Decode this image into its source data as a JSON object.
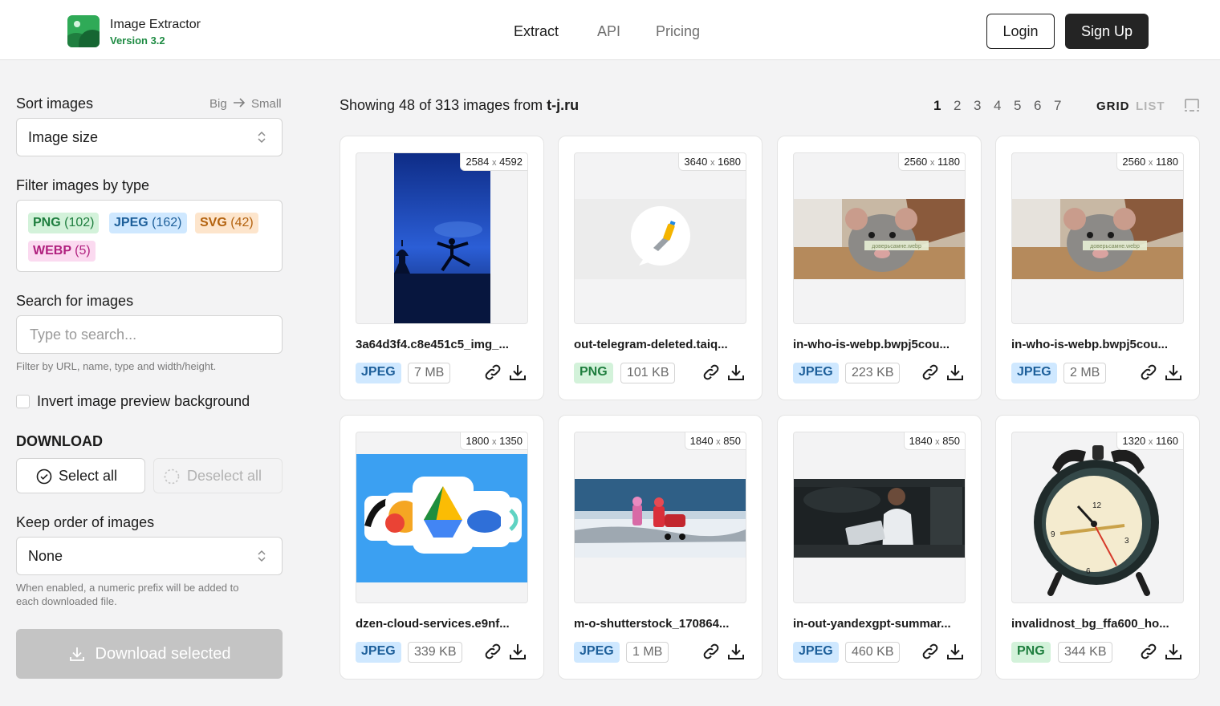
{
  "header": {
    "app_name": "Image Extractor",
    "version": "Version 3.2",
    "nav": [
      "Extract",
      "API",
      "Pricing"
    ],
    "login": "Login",
    "signup": "Sign Up"
  },
  "sidebar": {
    "sort_label": "Sort images",
    "sort_big": "Big",
    "sort_small": "Small",
    "sort_value": "Image size",
    "filter_label": "Filter images by type",
    "filters": [
      {
        "type": "PNG",
        "count": "(102)"
      },
      {
        "type": "JPEG",
        "count": "(162)"
      },
      {
        "type": "SVG",
        "count": "(42)"
      },
      {
        "type": "WEBP",
        "count": "(5)"
      }
    ],
    "search_label": "Search for images",
    "search_placeholder": "Type to search...",
    "search_hint": "Filter by URL, name, type and width/height.",
    "invert_label": "Invert image preview background",
    "download_title": "DOWNLOAD",
    "select_all": "Select all",
    "deselect_all": "Deselect all",
    "order_label": "Keep order of images",
    "order_value": "None",
    "order_hint_1": "When enabled, a numeric prefix will be added to",
    "order_hint_2": "each downloaded file.",
    "download_selected": "Download selected"
  },
  "main": {
    "showing_prefix": "Showing 48 of 313 images from",
    "domain": "t-j.ru",
    "pages": [
      "1",
      "2",
      "3",
      "4",
      "5",
      "6",
      "7"
    ],
    "view_grid": "GRID",
    "view_list": "LIST"
  },
  "images": [
    {
      "w": "2584",
      "h": "4592",
      "name": "3a64d3f4.c8e451c5_img_...",
      "type": "JPEG",
      "size": "7 MB"
    },
    {
      "w": "3640",
      "h": "1680",
      "name": "out-telegram-deleted.taiq...",
      "type": "PNG",
      "size": "101 KB"
    },
    {
      "w": "2560",
      "h": "1180",
      "name": "in-who-is-webp.bwpj5cou...",
      "type": "JPEG",
      "size": "223 KB"
    },
    {
      "w": "2560",
      "h": "1180",
      "name": "in-who-is-webp.bwpj5cou...",
      "type": "JPEG",
      "size": "2 MB"
    },
    {
      "w": "1800",
      "h": "1350",
      "name": "dzen-cloud-services.e9nf...",
      "type": "JPEG",
      "size": "339 KB"
    },
    {
      "w": "1840",
      "h": "850",
      "name": "m-o-shutterstock_170864...",
      "type": "JPEG",
      "size": "1 MB"
    },
    {
      "w": "1840",
      "h": "850",
      "name": "in-out-yandexgpt-summar...",
      "type": "JPEG",
      "size": "460 KB"
    },
    {
      "w": "1320",
      "h": "1160",
      "name": "invalidnost_bg_ffa600_ho...",
      "type": "PNG",
      "size": "344 KB"
    }
  ],
  "clock_labels": [
    "12",
    "9",
    "3",
    "6"
  ],
  "rat_caption": "доверьсамне.webp",
  "colors": {
    "accent": "#1e8b43",
    "png": "#d3f2da",
    "jpeg": "#cfe8ff",
    "svg": "#fde5cc",
    "webp": "#fbdaf0"
  }
}
